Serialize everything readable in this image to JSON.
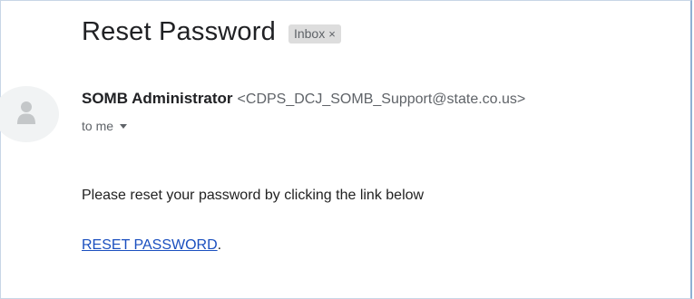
{
  "email": {
    "subject": "Reset Password",
    "label": "Inbox",
    "label_remove_glyph": "×",
    "sender_name": "SOMB Administrator",
    "sender_email": "<CDPS_DCJ_SOMB_Support@state.co.us>",
    "recipient": "to me",
    "body_line": "Please reset your password by clicking the link below",
    "link_text": "RESET PASSWORD",
    "link_suffix": "."
  },
  "icons": {
    "avatar": "person-icon",
    "recipient_toggle": "chevron-down-icon",
    "label_remove": "close-icon"
  },
  "colors": {
    "link": "#1a4fbf",
    "subject": "#202124",
    "muted": "#5f6368",
    "chip_background": "#dddddd",
    "avatar_background": "#f1f3f4"
  }
}
